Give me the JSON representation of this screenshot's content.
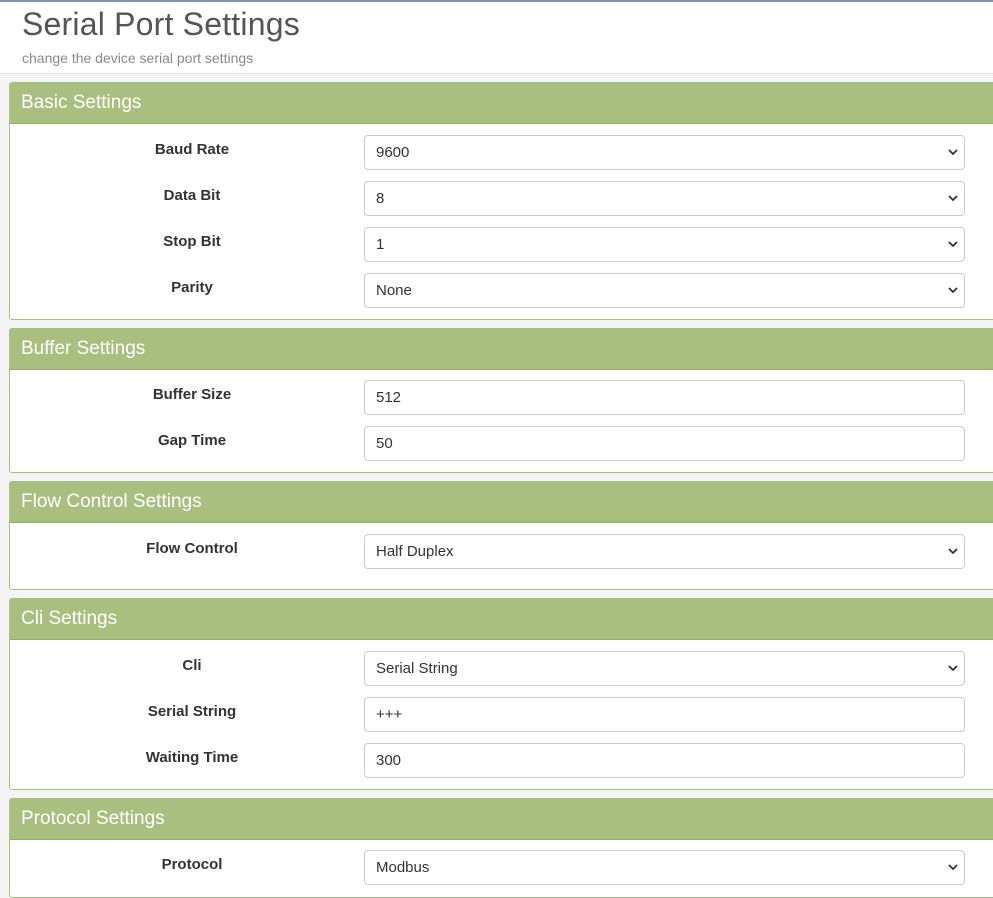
{
  "header": {
    "title": "Serial Port Settings",
    "subtitle": "change the device serial port settings"
  },
  "sections": {
    "basic": {
      "title": "Basic Settings",
      "baud_rate": {
        "label": "Baud Rate",
        "value": "9600"
      },
      "data_bit": {
        "label": "Data Bit",
        "value": "8"
      },
      "stop_bit": {
        "label": "Stop Bit",
        "value": "1"
      },
      "parity": {
        "label": "Parity",
        "value": "None"
      }
    },
    "buffer": {
      "title": "Buffer Settings",
      "buffer_size": {
        "label": "Buffer Size",
        "value": "512"
      },
      "gap_time": {
        "label": "Gap Time",
        "value": "50"
      }
    },
    "flow": {
      "title": "Flow Control Settings",
      "flow_control": {
        "label": "Flow Control",
        "value": "Half Duplex"
      }
    },
    "cli": {
      "title": "Cli Settings",
      "cli": {
        "label": "Cli",
        "value": "Serial String"
      },
      "serial_string": {
        "label": "Serial String",
        "value": "+++"
      },
      "waiting_time": {
        "label": "Waiting Time",
        "value": "300"
      }
    },
    "protocol": {
      "title": "Protocol Settings",
      "protocol": {
        "label": "Protocol",
        "value": "Modbus"
      }
    }
  },
  "icons": {
    "dropdown": "chevron-down-icon"
  },
  "colors": {
    "panel_header": "#a9bf80",
    "panel_border": "#a9bf81",
    "top_line": "#7a95b8"
  }
}
